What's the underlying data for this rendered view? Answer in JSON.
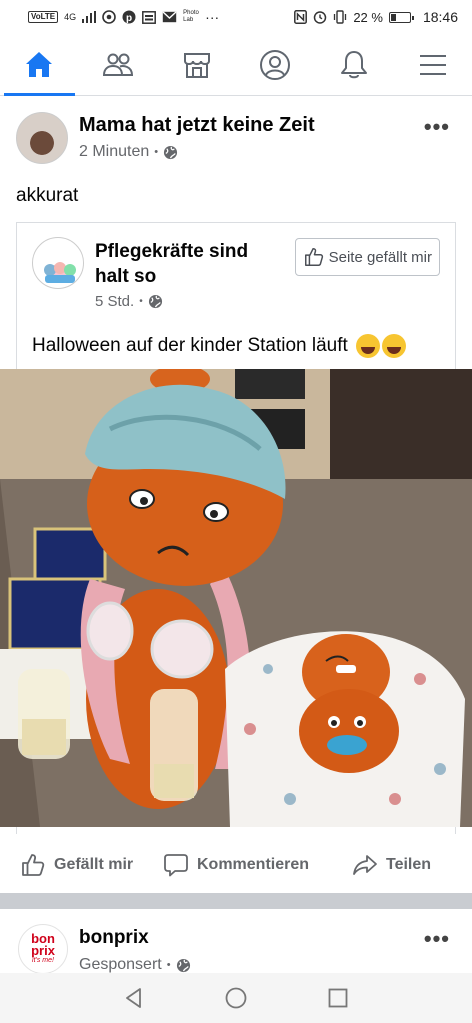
{
  "status_bar": {
    "left_chip": "VoLTE",
    "network": "4G",
    "photo_label": "Photo Lab",
    "dots": "···",
    "battery_text": "22 %",
    "time": "18:46"
  },
  "nav": {
    "items": [
      {
        "name": "home",
        "active": true
      },
      {
        "name": "friends",
        "active": false
      },
      {
        "name": "marketplace",
        "active": false
      },
      {
        "name": "profile",
        "active": false
      },
      {
        "name": "notifications",
        "active": false
      },
      {
        "name": "menu",
        "active": false
      }
    ],
    "accent": "#1877f2"
  },
  "post": {
    "author": "Mama hat jetzt keine Zeit",
    "time": "2 Minuten",
    "separator": "•",
    "more": "•••",
    "text": "akkurat",
    "shared": {
      "page_name": "Pflegekräfte sind halt so",
      "time": "5 Std.",
      "like_page_label": "Seite gefällt mir",
      "text": "Halloween auf der kinder Station läuft"
    },
    "actions": {
      "like": "Gefällt mir",
      "comment": "Kommentieren",
      "share": "Teilen"
    }
  },
  "ad": {
    "name": "bonprix",
    "label": "Gesponsert",
    "logo_top": "bon prix",
    "logo_sub": "it's me!"
  }
}
